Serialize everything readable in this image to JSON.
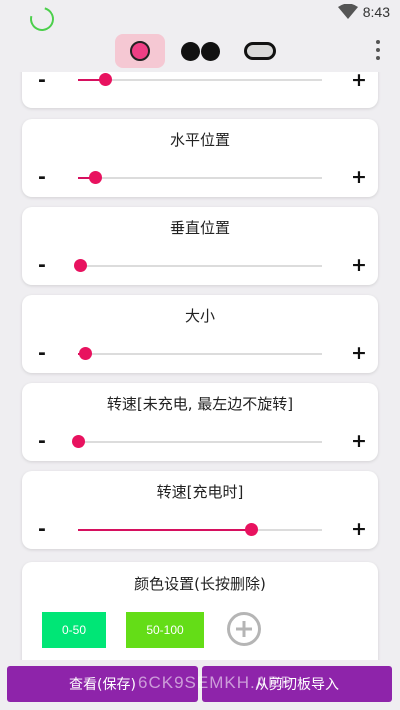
{
  "status_bar": {
    "time": "8:43"
  },
  "mode_tabs": [
    {
      "icon": "circle-icon",
      "selected": true
    },
    {
      "icon": "two-dots-icon",
      "selected": false
    },
    {
      "icon": "pill-icon",
      "selected": false
    }
  ],
  "sliders": [
    {
      "label": "",
      "minus": "-",
      "plus": "+",
      "value_fraction": 0.11
    },
    {
      "label": "水平位置",
      "minus": "-",
      "plus": "+",
      "value_fraction": 0.07
    },
    {
      "label": "垂直位置",
      "minus": "-",
      "plus": "+",
      "value_fraction": 0.01
    },
    {
      "label": "大小",
      "minus": "-",
      "plus": "+",
      "value_fraction": 0.03
    },
    {
      "label": "转速[未充电, 最左边不旋转]",
      "minus": "-",
      "plus": "+",
      "value_fraction": 0.0
    },
    {
      "label": "转速[充电时]",
      "minus": "-",
      "plus": "+",
      "value_fraction": 0.71
    }
  ],
  "colors": {
    "title": "颜色设置(长按删除)",
    "items": [
      {
        "label": "0-50",
        "color": "#00e676"
      },
      {
        "label": "50-100",
        "color": "#64dd17"
      }
    ]
  },
  "buttons": {
    "view_save": "查看(保存)",
    "import_clipboard": "从剪切板导入"
  },
  "watermark": "6CK9SEMKH.APP",
  "theme": {
    "accent": "#e8125f",
    "button": "#8e24aa",
    "tab_selected": "#f5c8d3"
  }
}
